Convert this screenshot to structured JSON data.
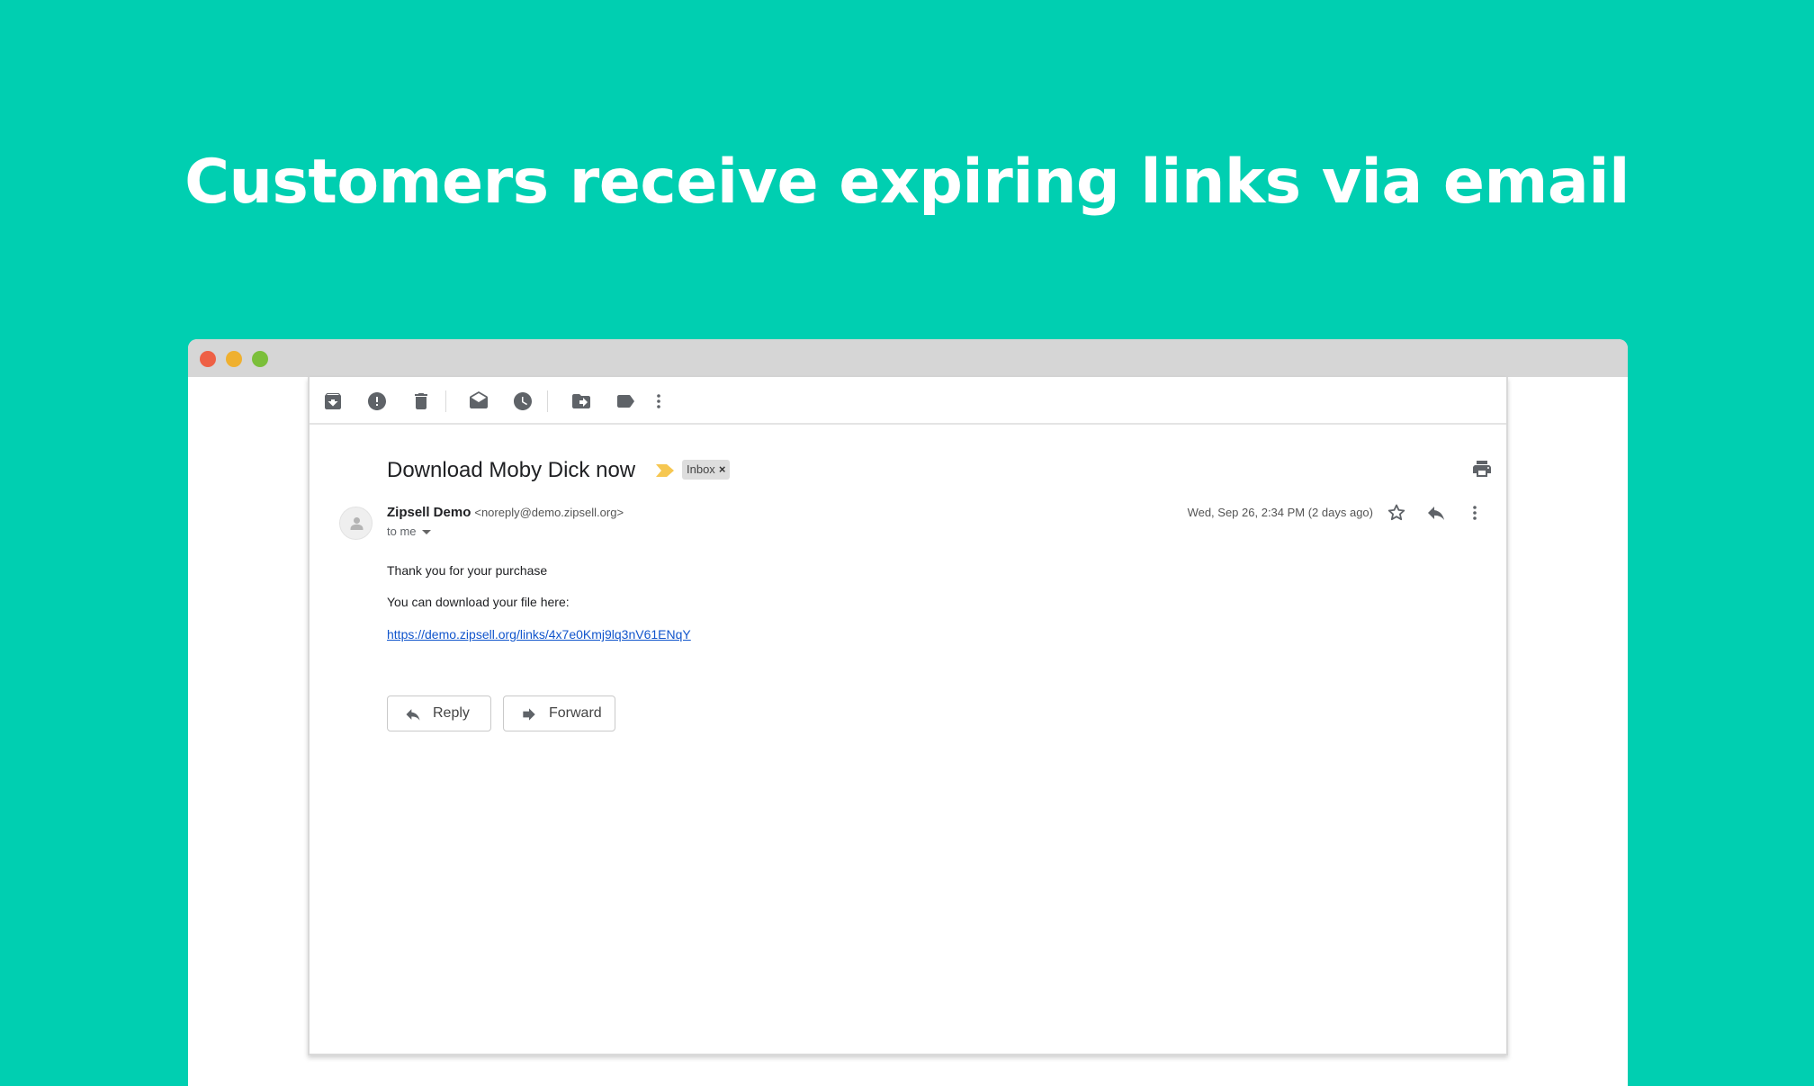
{
  "headline": "Customers receive expiring links via email",
  "window": {
    "controls": [
      "close",
      "minimize",
      "maximize"
    ],
    "colors": {
      "close": "#ee6045",
      "minimize": "#efb02f",
      "maximize": "#7bbf3a"
    }
  },
  "toolbar": {
    "icons": [
      "archive-icon",
      "report-spam-icon",
      "delete-icon",
      "mark-unread-icon",
      "snooze-icon",
      "move-to-icon",
      "label-icon",
      "more-vert-icon"
    ]
  },
  "email": {
    "subject": "Download Moby Dick now",
    "label": "Inbox",
    "label_close": "×",
    "sender_name": "Zipsell Demo",
    "sender_email": "<noreply@demo.zipsell.org>",
    "recipient": "to me",
    "date": "Wed, Sep 26, 2:34 PM (2 days ago)",
    "body": {
      "line1": "Thank you for your purchase",
      "line2": "You can download your file here:",
      "link": "https://demo.zipsell.org/links/4x7e0Kmj9lq3nV61ENqY"
    },
    "reply_label": "Reply",
    "forward_label": "Forward"
  },
  "colors": {
    "background": "#00cfb1",
    "link": "#1155cc",
    "importance": "#f6c751"
  }
}
